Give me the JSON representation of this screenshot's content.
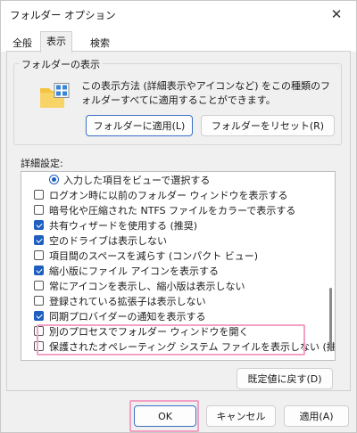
{
  "window": {
    "title": "フォルダー オプション",
    "close_glyph": "✕"
  },
  "tabs": [
    {
      "label": "全般",
      "active": false
    },
    {
      "label": "表示",
      "active": true
    },
    {
      "label": "検索",
      "active": false
    }
  ],
  "folder_view": {
    "group_label": "フォルダーの表示",
    "description": "この表示方法 (詳細表示やアイコンなど) をこの種類のフォルダーすべてに適用することができます。",
    "apply_button": "フォルダーに適用(L)",
    "reset_button": "フォルダーをリセット(R)"
  },
  "advanced": {
    "label": "詳細設定:",
    "items": [
      {
        "type": "radio",
        "checked": true,
        "label": "入力した項目をビューで選択する"
      },
      {
        "type": "checkbox",
        "checked": false,
        "label": "ログオン時に以前のフォルダー ウィンドウを表示する"
      },
      {
        "type": "checkbox",
        "checked": false,
        "label": "暗号化や圧縮された NTFS ファイルをカラーで表示する"
      },
      {
        "type": "checkbox",
        "checked": true,
        "label": "共有ウィザードを使用する (推奨)"
      },
      {
        "type": "checkbox",
        "checked": true,
        "label": "空のドライブは表示しない"
      },
      {
        "type": "checkbox",
        "checked": false,
        "label": "項目間のスペースを減らす (コンパクト ビュー)"
      },
      {
        "type": "checkbox",
        "checked": true,
        "label": "縮小版にファイル アイコンを表示する"
      },
      {
        "type": "checkbox",
        "checked": false,
        "label": "常にアイコンを表示し、縮小版は表示しない"
      },
      {
        "type": "checkbox",
        "checked": false,
        "label": "登録されている拡張子は表示しない"
      },
      {
        "type": "checkbox",
        "checked": true,
        "label": "同期プロバイダーの通知を表示する"
      },
      {
        "type": "checkbox",
        "checked": false,
        "label": "別のプロセスでフォルダー ウィンドウを開く"
      },
      {
        "type": "checkbox",
        "checked": false,
        "label": "保護されたオペレーティング システム ファイルを表示しない (推奨)"
      }
    ],
    "restore_button": "既定値に戻す(D)"
  },
  "footer": {
    "ok": "OK",
    "cancel": "キャンセル",
    "apply": "適用(A)"
  },
  "colors": {
    "accent": "#1f5fbf",
    "highlight": "#f2a0c4"
  }
}
